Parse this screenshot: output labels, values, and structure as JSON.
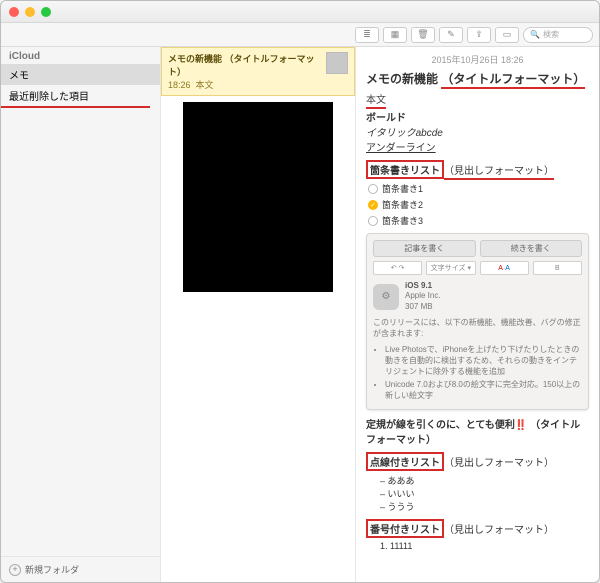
{
  "window": {
    "search_placeholder": "検索"
  },
  "toolbar_icons": [
    "list",
    "grid",
    "trash",
    "edit",
    "share",
    "box",
    "add"
  ],
  "sidebar": {
    "section": "iCloud",
    "items": [
      {
        "label": "メモ",
        "selected": true
      },
      {
        "label": "最近削除した項目",
        "underline": true
      }
    ],
    "new_folder": "新規フォルダ"
  },
  "notelist": {
    "card": {
      "title": "メモの新機能 （タイトルフォーマット）",
      "time": "18:26",
      "subtitle": "本文"
    }
  },
  "note": {
    "date": "2015年10月26日 18:26",
    "title_plain": "メモの新機能 ",
    "title_hl": "（タイトルフォーマット）",
    "body_lines": {
      "honbun": "本文",
      "bold": "ボールド",
      "italic": "イタリックabcde",
      "underline": "アンダーライン"
    },
    "bullet_heading_box": "箇条書きリスト",
    "bullet_heading_hl": "（見出しフォーマット）",
    "bullets": [
      {
        "label": "箇条書き1",
        "checked": false
      },
      {
        "label": "箇条書き2",
        "checked": true
      },
      {
        "label": "箇条書き3",
        "checked": false
      }
    ],
    "embed": {
      "tab1": "記事を書く",
      "tab2": "続きを書く",
      "fontsize": "文字サイズ ▾",
      "app": {
        "name": "iOS 9.1",
        "vendor": "Apple Inc.",
        "size": "307 MB"
      },
      "desc": "このリリースには、以下の新機能、機能改善、バグの修正が含まれます:",
      "li1": "Live Photosで、iPhoneを上げたり下げたりしたときの動きを自動的に検出するため、それらの動きをインテリジェントに除外する機能を追加",
      "li2": "Unicode 7.0および8.0の絵文字に完全対応。150以上の新しい絵文字"
    },
    "ruler_para_a": "定規が線を引くのに、とても便利",
    "ruler_emoji": "‼️",
    "ruler_para_b": "（タイトルフォーマット）",
    "dash_heading_box": "点線付きリスト",
    "dash_heading_rest": "（見出しフォーマット）",
    "dash_items": [
      "あああ",
      "いいい",
      "ううう"
    ],
    "num_heading_box": "番号付きリスト",
    "num_heading_rest": "（見出しフォーマット）",
    "num_item": "1. 11111"
  }
}
